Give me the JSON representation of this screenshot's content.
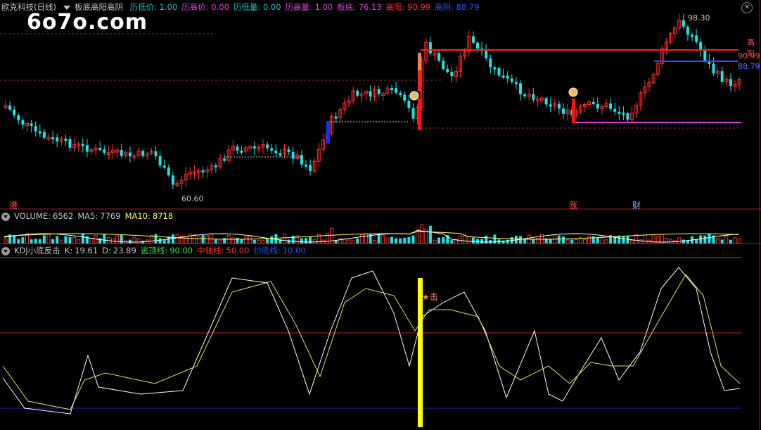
{
  "watermark": "6o7o.com",
  "main_header": {
    "title": "欧克科技(日线)",
    "indicator": "板底高阳高阴",
    "items": [
      {
        "label": "历低价:",
        "value": "1.00",
        "color": "#21c3c3"
      },
      {
        "label": "历高价:",
        "value": "0.00",
        "color": "#e040e0"
      },
      {
        "label": "历低量:",
        "value": "0.00",
        "color": "#21c3c3"
      },
      {
        "label": "历高量:",
        "value": "1.00",
        "color": "#e040e0"
      },
      {
        "label": "板底:",
        "value": "76.13",
        "color": "#e040e0"
      },
      {
        "label": "高阳:",
        "value": "90.99",
        "color": "#ff3030"
      },
      {
        "label": "高阴:",
        "value": "88.79",
        "color": "#2f4fff"
      }
    ]
  },
  "price_labels": {
    "high_peak": "98.30",
    "low_trough": "60.60",
    "right_tag": "高阳",
    "right_red": "90.99",
    "right_blue": "88.79"
  },
  "event_tags": {
    "gang": "港",
    "zhang": "涨",
    "cai": "财"
  },
  "volume_header": {
    "label": "VOLUME:",
    "value": "6562",
    "ma5_label": "MA5:",
    "ma5": "7769",
    "ma10_label": "MA10:",
    "ma10": "8718"
  },
  "kdj_header": {
    "name": "KDJ小底反击",
    "k_label": "K:",
    "k": "19.61",
    "d_label": "D:",
    "d": "23.89",
    "escape_label": "逃顶线:",
    "escape": "90.00",
    "mid_label": "中轴线:",
    "mid": "50.00",
    "bottom_label": "抄底线:",
    "bottom": "10.00"
  },
  "kdj_signal": "★击",
  "colors": {
    "up": "#ff3030",
    "down": "#21e3e3",
    "magenta": "#e040e0",
    "blue": "#2f4fff",
    "yellow": "#ffff00"
  }
}
